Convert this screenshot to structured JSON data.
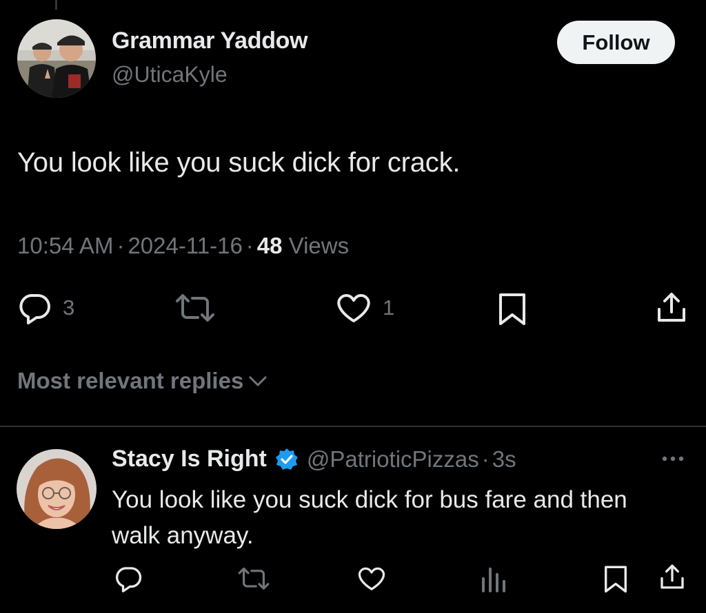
{
  "tweet": {
    "author": {
      "name": "Grammar Yaddow",
      "handle": "@UticaKyle"
    },
    "follow_label": "Follow",
    "text": "You look like you suck dick for crack.",
    "time": "10:54 AM",
    "date": "2024-11-16",
    "separator": "·",
    "views_count": "48",
    "views_label": "Views",
    "actions": {
      "replies": "3",
      "likes": "1"
    }
  },
  "replies_filter": {
    "label": "Most relevant replies",
    "icon": "chevron-down-icon"
  },
  "reply": {
    "author": {
      "name": "Stacy Is Right",
      "handle": "@PatrioticPizzas",
      "verified": true
    },
    "separator": "·",
    "time": "3s",
    "text": "You look like you suck dick for bus fare and then walk anyway."
  },
  "colors": {
    "background": "#000000",
    "text_primary": "#e7e9ea",
    "text_secondary": "#71767b",
    "verified_blue": "#1d9bf0",
    "follow_bg": "#eff3f4",
    "divider": "#2f3336"
  },
  "icons": {
    "tweet_actions": [
      "reply-icon",
      "retweet-icon",
      "like-icon",
      "bookmark-icon",
      "share-icon"
    ],
    "reply_actions": [
      "reply-icon",
      "retweet-icon",
      "like-icon",
      "views-icon",
      "bookmark-icon",
      "share-icon"
    ]
  }
}
